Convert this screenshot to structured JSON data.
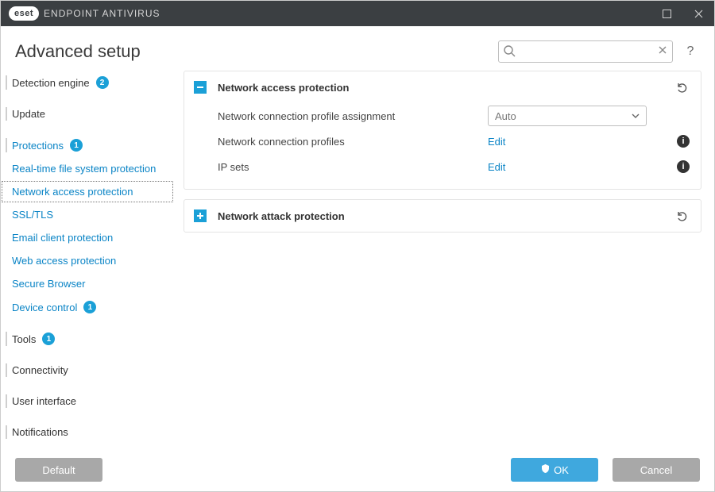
{
  "titlebar": {
    "brand_pill": "eset",
    "brand_text": "ENDPOINT ANTIVIRUS"
  },
  "header": {
    "title": "Advanced setup",
    "search_placeholder": "",
    "help_label": "?"
  },
  "sidebar": {
    "items": [
      {
        "label": "Detection engine",
        "badge": "2",
        "top": true
      },
      {
        "label": "Update",
        "top": true
      },
      {
        "label": "Protections",
        "badge": "1",
        "top": true
      },
      {
        "label": "Real-time file system protection",
        "link": true,
        "sub": true
      },
      {
        "label": "Network access protection",
        "link": true,
        "sub": true,
        "selected": true
      },
      {
        "label": "SSL/TLS",
        "link": true,
        "sub": true
      },
      {
        "label": "Email client protection",
        "link": true,
        "sub": true
      },
      {
        "label": "Web access protection",
        "link": true,
        "sub": true
      },
      {
        "label": "Secure Browser",
        "link": true,
        "sub": true
      },
      {
        "label": "Device control",
        "badge": "1",
        "link": true,
        "sub": true
      },
      {
        "label": "Tools",
        "badge": "1",
        "top": true
      },
      {
        "label": "Connectivity",
        "top": true
      },
      {
        "label": "User interface",
        "top": true
      },
      {
        "label": "Notifications",
        "top": true
      }
    ]
  },
  "main": {
    "panels": [
      {
        "expanded": true,
        "title": "Network access protection",
        "rows": [
          {
            "label": "Network connection profile assignment",
            "control": "dropdown",
            "value": "Auto"
          },
          {
            "label": "Network connection profiles",
            "control": "edit",
            "value": "Edit",
            "info": true
          },
          {
            "label": "IP sets",
            "control": "edit",
            "value": "Edit",
            "info": true
          }
        ]
      },
      {
        "expanded": false,
        "title": "Network attack protection"
      }
    ]
  },
  "footer": {
    "default_label": "Default",
    "ok_label": "OK",
    "cancel_label": "Cancel"
  }
}
